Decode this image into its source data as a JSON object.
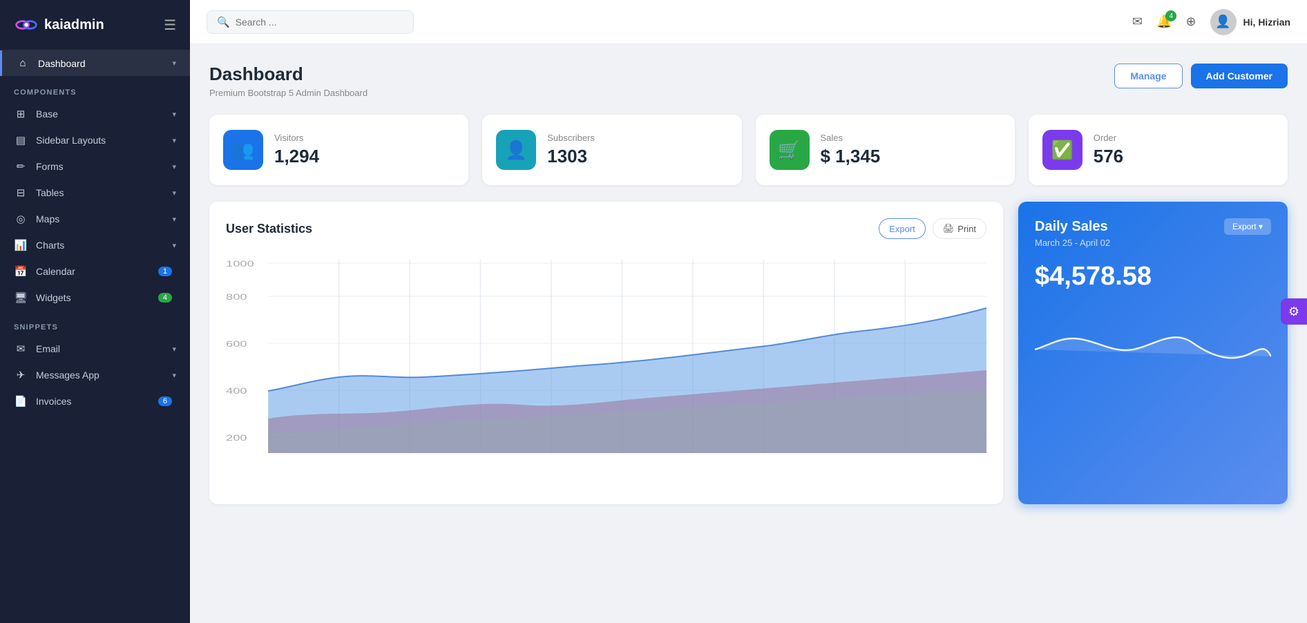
{
  "app": {
    "name": "kaiadmin"
  },
  "topbar": {
    "search_placeholder": "Search ...",
    "notif_count": "4",
    "user_greeting": "Hi, ",
    "user_name": "Hizrian"
  },
  "sidebar": {
    "dashboard_label": "Dashboard",
    "components_label": "COMPONENTS",
    "snippets_label": "SNIPPETS",
    "items": [
      {
        "label": "Base",
        "icon": "⊞"
      },
      {
        "label": "Sidebar Layouts",
        "icon": "▤"
      },
      {
        "label": "Forms",
        "icon": "✏"
      },
      {
        "label": "Tables",
        "icon": "⊟"
      },
      {
        "label": "Maps",
        "icon": "◎"
      },
      {
        "label": "Charts",
        "icon": "📊"
      },
      {
        "label": "Calendar",
        "icon": "📅",
        "badge": "1"
      },
      {
        "label": "Widgets",
        "icon": "🖥",
        "badge": "4",
        "badge_color": "green"
      }
    ],
    "snippet_items": [
      {
        "label": "Email",
        "icon": "✉"
      },
      {
        "label": "Messages App",
        "icon": "✈"
      },
      {
        "label": "Invoices",
        "icon": "📄",
        "badge": "6"
      }
    ]
  },
  "page": {
    "title": "Dashboard",
    "subtitle": "Premium Bootstrap 5 Admin Dashboard",
    "manage_label": "Manage",
    "add_customer_label": "Add Customer"
  },
  "stats": [
    {
      "label": "Visitors",
      "value": "1,294",
      "icon_color": "blue",
      "icon": "👥"
    },
    {
      "label": "Subscribers",
      "value": "1303",
      "icon_color": "lightblue",
      "icon": "👤"
    },
    {
      "label": "Sales",
      "value": "$ 1,345",
      "icon_color": "green",
      "icon": "🛒"
    },
    {
      "label": "Order",
      "value": "576",
      "icon_color": "purple",
      "icon": "✅"
    }
  ],
  "user_statistics": {
    "title": "User Statistics",
    "export_label": "Export",
    "print_label": "Print",
    "y_labels": [
      "1000",
      "800",
      "600",
      "400",
      "200"
    ]
  },
  "daily_sales": {
    "title": "Daily Sales",
    "period": "March 25 - April 02",
    "amount": "$4,578.58",
    "export_label": "Export ▾"
  }
}
